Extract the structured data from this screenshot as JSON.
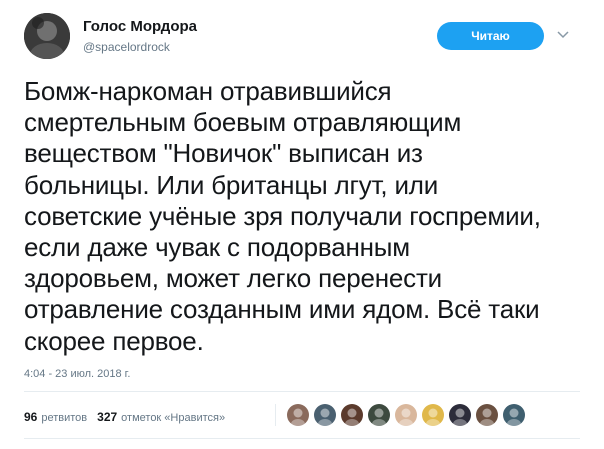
{
  "author": {
    "display_name": "Голос Мордора",
    "handle": "@spacelordrock"
  },
  "follow_button": {
    "label": "Читаю",
    "color": "#1da1f2"
  },
  "tweet": {
    "text": "Бомж-наркоман отравившийся\nсмертельным боевым отравляющим\nвеществом \"Новичок\" выписан из\nбольницы. Или британцы лгут, или\nсоветские учёные зря получали госпремии,\nесли даже чувак с подорванным\nздоровьем, может легко перенести\nотравление созданным ими ядом. Всё таки\nскорее первое.",
    "timestamp": "4:04 - 23 июл. 2018 г."
  },
  "stats": {
    "retweets_count": "96",
    "retweets_label": "ретвитов",
    "likes_count": "327",
    "likes_label": "отметок «Нравится»"
  },
  "likers": [
    {
      "icon": "user-avatar-icon",
      "color": "#8a6a5c"
    },
    {
      "icon": "user-avatar-icon",
      "color": "#4a6070"
    },
    {
      "icon": "user-avatar-icon",
      "color": "#5b3a2c"
    },
    {
      "icon": "user-avatar-icon",
      "color": "#3d4a3f"
    },
    {
      "icon": "user-avatar-icon",
      "color": "#d9b79c"
    },
    {
      "icon": "user-avatar-icon",
      "color": "#e0b84a"
    },
    {
      "icon": "user-avatar-icon",
      "color": "#2c2c3a"
    },
    {
      "icon": "user-avatar-icon",
      "color": "#6a5040"
    },
    {
      "icon": "user-avatar-icon",
      "color": "#3f5f6f"
    }
  ],
  "icons": {
    "caret": "chevron-down-icon",
    "avatar": "profile-avatar-icon"
  }
}
